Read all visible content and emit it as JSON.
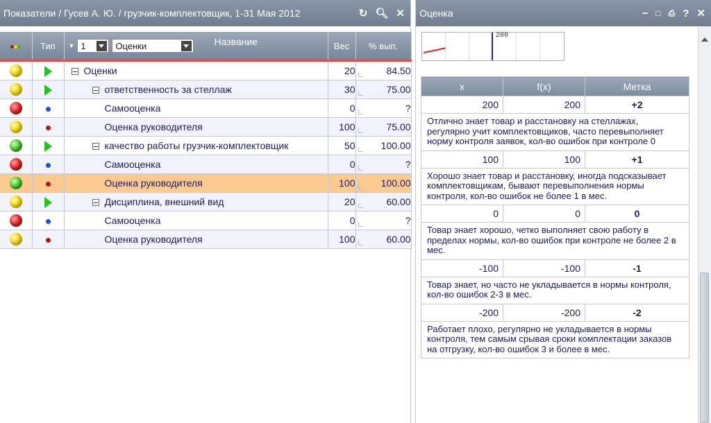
{
  "left": {
    "title": "Показатели / Гусев А. Ю. / грузчик-комплектовщик, 1-31 Мая 2012",
    "icons": [
      "refresh-icon",
      "search-icon",
      "close-icon"
    ],
    "header": {
      "type_label": "Тип",
      "level_value": "1",
      "group_value": "Оценки",
      "name_label": "Название",
      "weight_label": "Вес",
      "pct_label": "% вып."
    },
    "rows": [
      {
        "status": "yellow",
        "type": "triangle",
        "indent": 0,
        "toggle": true,
        "name": "Оценки",
        "weight": "20",
        "pct": "84.50"
      },
      {
        "status": "yellow",
        "type": "triangle",
        "indent": 1,
        "toggle": true,
        "name": "ответственность за стеллаж",
        "weight": "30",
        "pct": "75.00"
      },
      {
        "status": "red",
        "type": "blue-dot",
        "indent": 2,
        "toggle": false,
        "name": "Самооценка",
        "weight": "0",
        "pct": "?"
      },
      {
        "status": "yellow",
        "type": "red-dot",
        "indent": 2,
        "toggle": false,
        "name": "Оценка руководителя",
        "weight": "100",
        "pct": "75.00"
      },
      {
        "status": "green",
        "type": "triangle",
        "indent": 1,
        "toggle": true,
        "name": "качество работы грузчик-комплектовщик",
        "weight": "50",
        "pct": "100.00"
      },
      {
        "status": "red",
        "type": "blue-dot",
        "indent": 2,
        "toggle": false,
        "name": "Самооценка",
        "weight": "0",
        "pct": "?"
      },
      {
        "status": "green",
        "type": "red-dot",
        "indent": 2,
        "toggle": false,
        "name": "Оценка руководителя",
        "weight": "100",
        "pct": "100.00",
        "selected": true
      },
      {
        "status": "yellow",
        "type": "triangle",
        "indent": 1,
        "toggle": true,
        "name": "Дисциплина, внешний вид",
        "weight": "20",
        "pct": "60.00"
      },
      {
        "status": "red",
        "type": "blue-dot",
        "indent": 2,
        "toggle": false,
        "name": "Самооценка",
        "weight": "0",
        "pct": "?"
      },
      {
        "status": "yellow",
        "type": "red-dot",
        "indent": 2,
        "toggle": false,
        "name": "Оценка руководителя",
        "weight": "100",
        "pct": "60.00"
      }
    ]
  },
  "right": {
    "title": "Оценка",
    "icons": [
      "minimize-icon",
      "maximize-icon",
      "print-icon",
      "help-icon",
      "close-icon"
    ],
    "chart_label": "200",
    "columns": [
      "x",
      "f(x)",
      "Метка"
    ],
    "rows": [
      {
        "x": "200",
        "fx": "200",
        "mark": "+2",
        "desc": "Отлично знает товар и расстановку на стеллажах, регулярно учит комплектовщиков, часто перевыполняет норму контроля заявок, кол-во ошибок при контроле 0"
      },
      {
        "x": "100",
        "fx": "100",
        "mark": "+1",
        "desc": "Хорошо знает товар и расстановку, иногда подсказывает комплектовщикам, бывают перевыполнения нормы контроля, кол-во ошибок не более 1 в мес."
      },
      {
        "x": "0",
        "fx": "0",
        "mark": "0",
        "desc": "Товар знает хорошо, четко выполняет свою работу в пределах нормы, кол-во ошибок при контроле не более 2 в мес."
      },
      {
        "x": "-100",
        "fx": "-100",
        "mark": "-1",
        "desc": "Товар знает, но часто не укладывается в нормы контроля, кол-во ошибок 2-3 в мес."
      },
      {
        "x": "-200",
        "fx": "-200",
        "mark": "-2",
        "desc": "Работает плохо, регулярно не укладывается в нормы контроля, тем самым срывая сроки комплектации заказов на отгрузку, кол-во ошибок 3 и более в мес."
      }
    ]
  }
}
